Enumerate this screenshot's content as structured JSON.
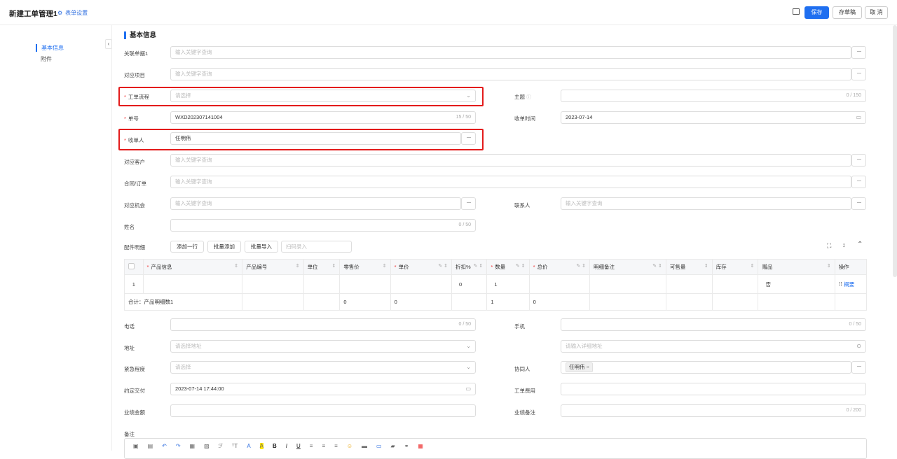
{
  "header": {
    "title": "新建工单管理1",
    "settings": "表单设置",
    "save": "保存",
    "draft": "存草稿",
    "cancel": "取 消"
  },
  "sidebar": {
    "items": [
      {
        "label": "基本信息"
      },
      {
        "label": "附件"
      }
    ]
  },
  "section": {
    "title": "基本信息"
  },
  "fields": {
    "related_doc": {
      "label": "关联单据1",
      "placeholder": "输入关键字查询"
    },
    "project": {
      "label": "对应项目",
      "placeholder": "输入关键字查询"
    },
    "workflow": {
      "label": "工单流程",
      "placeholder": "请选择"
    },
    "subject": {
      "label": "主题",
      "count": "0 / 150"
    },
    "number": {
      "label": "单号",
      "value": "WXD202307141004",
      "count": "15 / 50"
    },
    "receive_time": {
      "label": "收单时间",
      "value": "2023-07-14"
    },
    "receiver": {
      "label": "收单人",
      "value": "任明伟"
    },
    "customer": {
      "label": "对应客户",
      "placeholder": "输入关键字查询"
    },
    "contract": {
      "label": "合同/订单",
      "placeholder": "输入关键字查询"
    },
    "opportunity": {
      "label": "对应机会",
      "placeholder": "输入关键字查询"
    },
    "contact": {
      "label": "联系人",
      "placeholder": "输入关键字查询"
    },
    "name": {
      "label": "姓名",
      "count": "0 / 50"
    },
    "parts": {
      "label": "配件明细"
    },
    "phone": {
      "label": "电话",
      "count": "0 / 50"
    },
    "mobile": {
      "label": "手机",
      "count": "0 / 50"
    },
    "address": {
      "label": "地址",
      "placeholder": "请选择地址",
      "detail_placeholder": "请输入详细地址"
    },
    "urgency": {
      "label": "紧急程度",
      "placeholder": "请选择"
    },
    "collaborator": {
      "label": "协同人",
      "tag": "任明伟"
    },
    "delivery": {
      "label": "约定交付",
      "value": "2023-07-14 17:44:00"
    },
    "fee": {
      "label": "工单费用"
    },
    "amount": {
      "label": "业绩金额"
    },
    "remark_perf": {
      "label": "业绩备注",
      "count": "0 / 200"
    },
    "remark": {
      "label": "备注"
    }
  },
  "parts_toolbar": {
    "add_row": "添加一行",
    "batch_add": "批量添加",
    "batch_import": "批量导入",
    "scan_placeholder": "扫码录入"
  },
  "table": {
    "headers": [
      "产品信息",
      "产品编号",
      "单位",
      "零售价",
      "单价",
      "折扣%",
      "数量",
      "总价",
      "明细备注",
      "可售量",
      "库存",
      "赠品",
      "操作"
    ],
    "row": {
      "index": "1",
      "discount": "0",
      "qty": "1",
      "gift": "否",
      "op": "概要"
    },
    "total": {
      "label": "合计：产品明细数1",
      "retail": "0",
      "price": "0",
      "qty": "1",
      "total": "0"
    }
  },
  "colors": {
    "accent": "#1f6ff0",
    "required": "#e33",
    "highlight": "#e31b1b"
  }
}
